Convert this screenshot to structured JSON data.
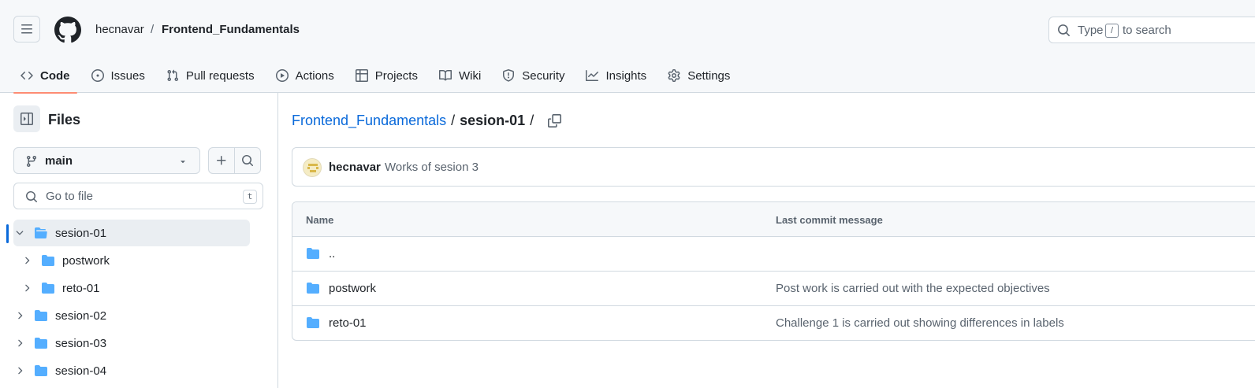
{
  "header": {
    "owner": "hecnavar",
    "separator": "/",
    "repo": "Frontend_Fundamentals",
    "search": {
      "prefix": "Type",
      "key": "/",
      "suffix": "to search"
    }
  },
  "nav": {
    "items": [
      {
        "label": "Code",
        "icon": "code-icon",
        "active": true
      },
      {
        "label": "Issues",
        "icon": "issue-opened-icon"
      },
      {
        "label": "Pull requests",
        "icon": "git-pull-request-icon"
      },
      {
        "label": "Actions",
        "icon": "play-icon"
      },
      {
        "label": "Projects",
        "icon": "table-icon"
      },
      {
        "label": "Wiki",
        "icon": "book-icon"
      },
      {
        "label": "Security",
        "icon": "shield-icon"
      },
      {
        "label": "Insights",
        "icon": "graph-icon"
      },
      {
        "label": "Settings",
        "icon": "gear-icon"
      }
    ]
  },
  "sidebar": {
    "title": "Files",
    "branch": "main",
    "goto_placeholder": "Go to file",
    "goto_key": "t",
    "tree": [
      {
        "label": "sesion-01",
        "expanded": true,
        "selected": true,
        "depth": 0
      },
      {
        "label": "postwork",
        "expanded": false,
        "depth": 1
      },
      {
        "label": "reto-01",
        "expanded": false,
        "depth": 1
      },
      {
        "label": "sesion-02",
        "expanded": false,
        "depth": 0
      },
      {
        "label": "sesion-03",
        "expanded": false,
        "depth": 0
      },
      {
        "label": "sesion-04",
        "expanded": false,
        "depth": 0
      }
    ]
  },
  "main": {
    "path": {
      "repo": "Frontend_Fundamentals",
      "sep": "/",
      "current": "sesion-01",
      "trail": "/"
    },
    "commit": {
      "author": "hecnavar",
      "message": "Works of sesion 3"
    },
    "table": {
      "headers": {
        "name": "Name",
        "message": "Last commit message"
      },
      "rows": [
        {
          "name": "..",
          "message": ""
        },
        {
          "name": "postwork",
          "message": "Post work is carried out with the expected objectives"
        },
        {
          "name": "reto-01",
          "message": "Challenge 1 is carried out showing differences in labels"
        }
      ]
    }
  },
  "colors": {
    "folder": "#54aeff",
    "link": "#0969da",
    "accent_underline": "#fd8c73",
    "border": "#d1d9e0",
    "muted": "#59636e"
  }
}
